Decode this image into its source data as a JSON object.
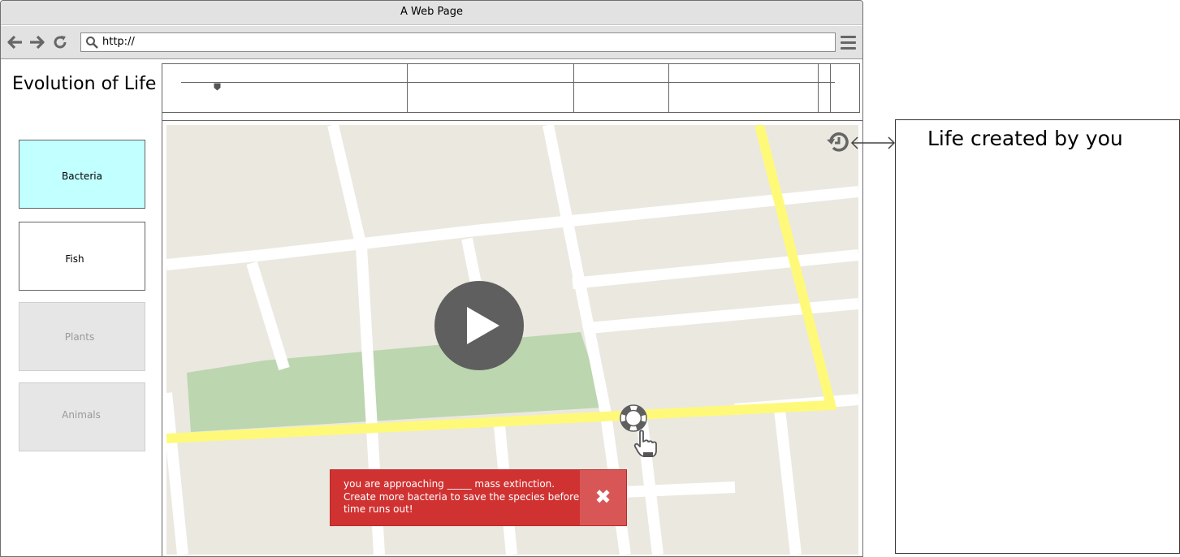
{
  "browser": {
    "window_title": "A Web Page",
    "url": "http://",
    "buttons": {
      "back": "back-arrow-icon",
      "forward": "forward-arrow-icon",
      "reload": "reload-icon",
      "menu": "hamburger-menu-icon"
    }
  },
  "page": {
    "title": "Evolution of Life",
    "timeline": {
      "position": 0.05
    },
    "categories": [
      {
        "label": "Bacteria",
        "state": "selected"
      },
      {
        "label": "Fish",
        "state": "enabled"
      },
      {
        "label": "Plants",
        "state": "disabled"
      },
      {
        "label": "Animals",
        "state": "disabled"
      }
    ],
    "map": {
      "play_icon": "play-icon",
      "marker_icon": "lifebuoy-icon",
      "cursor_icon": "hand-pointer-icon",
      "history_icon": "history-icon",
      "link_icon": "double-arrow-icon"
    },
    "alert": {
      "message": "you are approaching _____ mass extinction. Create more bacteria to save the species before time runs out!",
      "close_icon": "close-x-icon"
    },
    "side_panel": {
      "title": "Life created by you"
    }
  },
  "colors": {
    "selected_category": "#c2ffff",
    "disabled_category": "#e6e6e6",
    "alert_bg": "#d03232",
    "alert_close_bg": "#d95656",
    "map_road_highlight": "#fff97a",
    "map_park": "#bcd6b0",
    "map_ground": "#ebe8e0"
  }
}
